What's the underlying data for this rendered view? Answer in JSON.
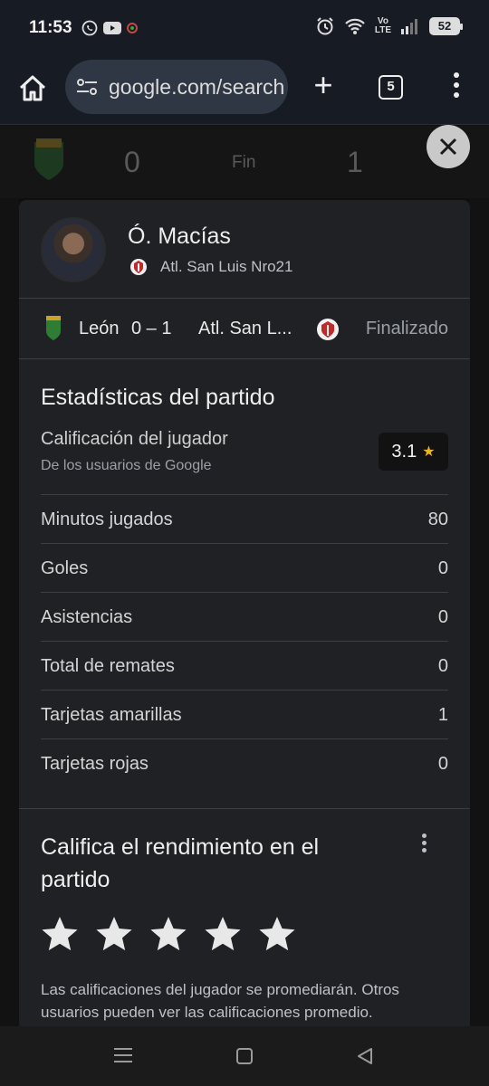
{
  "status_bar": {
    "time": "11:53",
    "battery": "52",
    "network_label_top": "Vo",
    "network_label_bottom": "LTE"
  },
  "browser": {
    "url": "google.com/search",
    "tab_count": "5"
  },
  "scoreboard": {
    "home_score": "0",
    "status": "Fin",
    "away_score": "1"
  },
  "player": {
    "name": "Ó. Macías",
    "club": "Atl. San Luis Nro21"
  },
  "match": {
    "home_team": "León",
    "score": "0  –  1",
    "away_team": "Atl. San L...",
    "status": "Finalizado"
  },
  "stats": {
    "title": "Estadísticas del partido",
    "rating_label": "Calificación del jugador",
    "rating_source": "De los usuarios de Google",
    "rating_value": "3.1",
    "rows": [
      {
        "label": "Minutos jugados",
        "value": "80"
      },
      {
        "label": "Goles",
        "value": "0"
      },
      {
        "label": "Asistencias",
        "value": "0"
      },
      {
        "label": "Total de remates",
        "value": "0"
      },
      {
        "label": "Tarjetas amarillas",
        "value": "1"
      },
      {
        "label": "Tarjetas rojas",
        "value": "0"
      }
    ]
  },
  "rate": {
    "title": "Califica el rendimiento en el partido",
    "star_count": 5,
    "note": "Las calificaciones del jugador se promediarán. Otros usuarios pueden ver las calificaciones promedio."
  },
  "colors": {
    "accent_star": "#f4b400",
    "card_bg": "#202124",
    "toolbar_bg": "#161b24"
  }
}
